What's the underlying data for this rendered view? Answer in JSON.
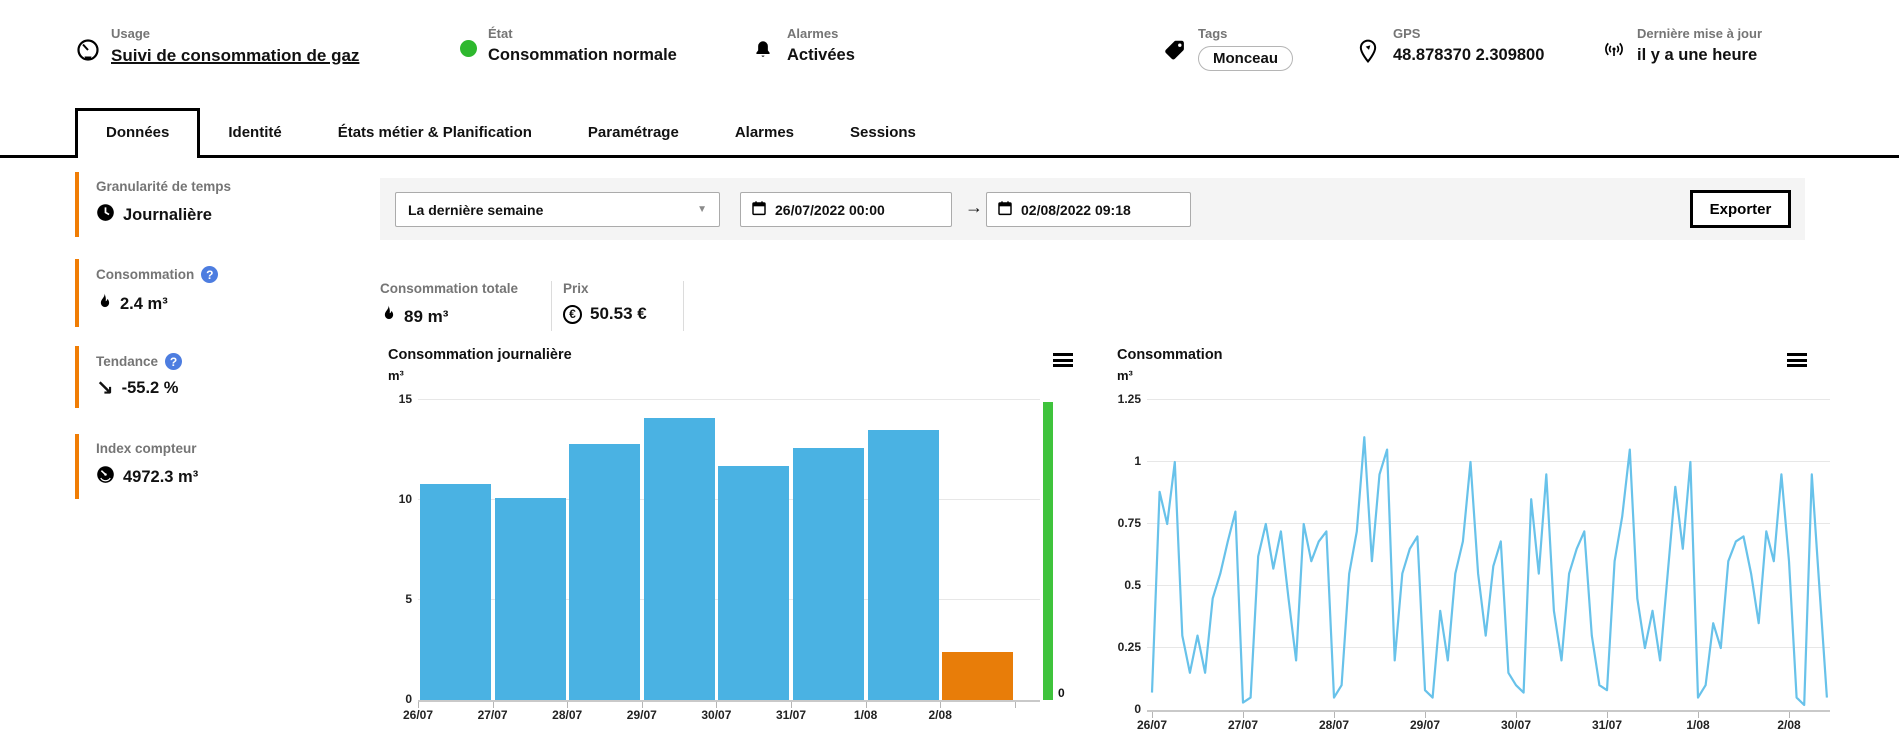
{
  "header": {
    "usage": {
      "label": "Usage",
      "value": "Suivi de consommation de gaz"
    },
    "etat": {
      "label": "État",
      "value": "Consommation normale",
      "status_color": "#2eb82e"
    },
    "alarmes": {
      "label": "Alarmes",
      "value": "Activées"
    },
    "tags": {
      "label": "Tags",
      "value": "Monceau"
    },
    "gps": {
      "label": "GPS",
      "value": "48.878370 2.309800"
    },
    "last_update": {
      "label": "Dernière mise à jour",
      "value": "il y a une heure"
    }
  },
  "tabs": [
    {
      "label": "Données",
      "active": true
    },
    {
      "label": "Identité",
      "active": false
    },
    {
      "label": "États métier & Planification",
      "active": false
    },
    {
      "label": "Paramétrage",
      "active": false
    },
    {
      "label": "Alarmes",
      "active": false
    },
    {
      "label": "Sessions",
      "active": false
    }
  ],
  "sidebar": {
    "accent_color": "#f07d05",
    "help_color": "#4d7de0",
    "items": [
      {
        "label": "Granularité de temps",
        "value": "Journalière",
        "icon": "clock-icon",
        "help": false
      },
      {
        "label": "Consommation",
        "value": "2.4 m³",
        "icon": "flame-icon",
        "help": true
      },
      {
        "label": "Tendance",
        "value": "-55.2 %",
        "icon": "trend-down-icon",
        "help": true
      },
      {
        "label": "Index compteur",
        "value": "4972.3 m³",
        "icon": "meter-icon",
        "help": false
      }
    ]
  },
  "filters": {
    "period": "La dernière semaine",
    "date_from": "26/07/2022 00:00",
    "date_to": "02/08/2022 09:18",
    "export_label": "Exporter"
  },
  "stats": {
    "total": {
      "label": "Consommation totale",
      "value": "89 m³"
    },
    "price": {
      "label": "Prix",
      "value": "50.53 €"
    }
  },
  "chart_data": [
    {
      "type": "bar",
      "title": "Consommation journalière",
      "unit": "m³",
      "categories": [
        "26/07",
        "27/07",
        "28/07",
        "29/07",
        "30/07",
        "31/07",
        "1/08",
        "2/08"
      ],
      "values": [
        10.8,
        10.1,
        12.8,
        14.1,
        11.7,
        12.6,
        13.5,
        2.4
      ],
      "bar_color": "#4ab2e3",
      "highlight_index": 7,
      "highlight_color": "#e87d09",
      "ylim": [
        0,
        15
      ],
      "yticks": [
        {
          "v": 0,
          "label": "0"
        },
        {
          "v": 5,
          "label": "5"
        },
        {
          "v": 10,
          "label": "10"
        },
        {
          "v": 15,
          "label": "15"
        }
      ],
      "grid": true,
      "legend_position": "none",
      "scale_bar": {
        "color": "#3fc33c",
        "label": "0"
      }
    },
    {
      "type": "line",
      "title": "Consommation",
      "unit": "m³",
      "x_labels": [
        "26/07",
        "27/07",
        "28/07",
        "29/07",
        "30/07",
        "31/07",
        "1/08",
        "2/08"
      ],
      "points_per_day": 12,
      "ylim": [
        0,
        1.25
      ],
      "yticks": [
        {
          "v": 0,
          "label": "0"
        },
        {
          "v": 0.25,
          "label": "0.25"
        },
        {
          "v": 0.5,
          "label": "0.5"
        },
        {
          "v": 0.75,
          "label": "0.75"
        },
        {
          "v": 1,
          "label": "1"
        },
        {
          "v": 1.25,
          "label": "1.25"
        }
      ],
      "line_color": "#68c2ea",
      "grid": true,
      "legend_position": "none",
      "values": [
        0.07,
        0.88,
        0.75,
        1.0,
        0.3,
        0.15,
        0.3,
        0.15,
        0.45,
        0.55,
        0.68,
        0.8,
        0.03,
        0.05,
        0.62,
        0.75,
        0.57,
        0.72,
        0.45,
        0.2,
        0.75,
        0.6,
        0.68,
        0.72,
        0.05,
        0.1,
        0.55,
        0.72,
        1.1,
        0.6,
        0.95,
        1.05,
        0.2,
        0.55,
        0.65,
        0.7,
        0.08,
        0.05,
        0.4,
        0.2,
        0.55,
        0.68,
        1.0,
        0.55,
        0.3,
        0.58,
        0.68,
        0.15,
        0.1,
        0.07,
        0.85,
        0.55,
        0.95,
        0.4,
        0.2,
        0.55,
        0.65,
        0.72,
        0.3,
        0.1,
        0.08,
        0.6,
        0.78,
        1.05,
        0.45,
        0.25,
        0.4,
        0.2,
        0.55,
        0.9,
        0.65,
        1.0,
        0.05,
        0.1,
        0.35,
        0.25,
        0.6,
        0.68,
        0.7,
        0.55,
        0.35,
        0.72,
        0.6,
        0.95,
        0.6,
        0.05,
        0.02,
        0.95,
        0.5,
        0.05
      ]
    }
  ]
}
